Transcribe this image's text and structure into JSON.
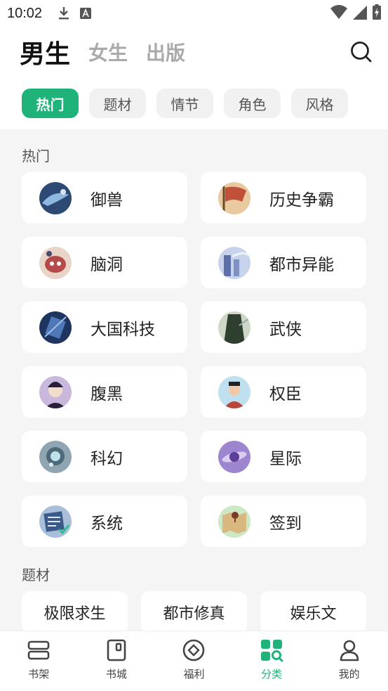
{
  "status": {
    "time": "10:02"
  },
  "header": {
    "tabs": [
      {
        "label": "男生",
        "active": true
      },
      {
        "label": "女生",
        "active": false
      },
      {
        "label": "出版",
        "active": false
      }
    ]
  },
  "chips": [
    {
      "label": "热门",
      "active": true
    },
    {
      "label": "题材",
      "active": false
    },
    {
      "label": "情节",
      "active": false
    },
    {
      "label": "角色",
      "active": false
    },
    {
      "label": "风格",
      "active": false
    }
  ],
  "sections": {
    "hot": {
      "title": "热门",
      "items": [
        {
          "label": "御兽",
          "icon": "beast-taming-thumb",
          "color": "#3a6ea8"
        },
        {
          "label": "历史争霸",
          "icon": "history-flag-thumb",
          "color": "#c0503a"
        },
        {
          "label": "脑洞",
          "icon": "brain-hole-thumb",
          "color": "#b44a4a"
        },
        {
          "label": "都市异能",
          "icon": "city-power-thumb",
          "color": "#5b6fa8"
        },
        {
          "label": "大国科技",
          "icon": "tech-thumb",
          "color": "#2f4f86"
        },
        {
          "label": "武侠",
          "icon": "wuxia-thumb",
          "color": "#3f5a3f"
        },
        {
          "label": "腹黑",
          "icon": "scheming-thumb",
          "color": "#4a3a6a"
        },
        {
          "label": "权臣",
          "icon": "minister-thumb",
          "color": "#b8453a"
        },
        {
          "label": "科幻",
          "icon": "scifi-thumb",
          "color": "#4d6a7a"
        },
        {
          "label": "星际",
          "icon": "interstellar-thumb",
          "color": "#7a5fb0"
        },
        {
          "label": "系统",
          "icon": "system-thumb",
          "color": "#3a5a8a"
        },
        {
          "label": "签到",
          "icon": "check-in-map-thumb",
          "color": "#c9a060"
        }
      ]
    },
    "theme": {
      "title": "题材",
      "items": [
        {
          "label": "极限求生"
        },
        {
          "label": "都市修真"
        },
        {
          "label": "娱乐文"
        }
      ]
    }
  },
  "bottom_nav": [
    {
      "label": "书架",
      "icon": "bookshelf-icon",
      "active": false
    },
    {
      "label": "书城",
      "icon": "bookstore-icon",
      "active": false
    },
    {
      "label": "福利",
      "icon": "welfare-icon",
      "active": false
    },
    {
      "label": "分类",
      "icon": "category-icon",
      "active": true
    },
    {
      "label": "我的",
      "icon": "profile-icon",
      "active": false
    }
  ],
  "colors": {
    "accent": "#1fb37a",
    "background": "#f5f5f5"
  }
}
